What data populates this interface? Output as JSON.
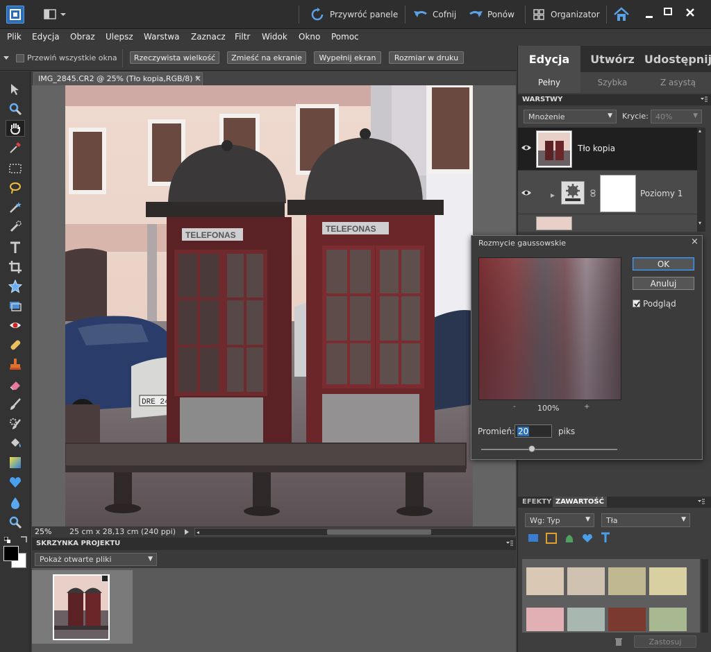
{
  "titlebar": {
    "restore_panels": "Przywróć panele",
    "undo": "Cofnij",
    "redo": "Ponów",
    "organizer": "Organizator"
  },
  "menu": [
    "Plik",
    "Edycja",
    "Obraz",
    "Ulepsz",
    "Warstwa",
    "Zaznacz",
    "Filtr",
    "Widok",
    "Okno",
    "Pomoc"
  ],
  "options": {
    "scroll_all_label": "Przewiń wszystkie okna",
    "actual_size": "Rzeczywista wielkość",
    "fit_screen": "Zmieść na ekranie",
    "fill_screen": "Wypełnij ekran",
    "print_size": "Rozmiar w druku"
  },
  "document": {
    "tab_title": "IMG_2845.CR2 @ 25% (Tło kopia,RGB/8) *",
    "close": "×",
    "zoom": "25%",
    "size_info": "25 cm x 28,13 cm (240 ppi)",
    "phone_sign": "TELEFONAS",
    "plate": "DRE 240"
  },
  "project_bin": {
    "title": "SKRZYNKA PROJEKTU",
    "dropdown": "Pokaż otwarte pliki"
  },
  "right_panel": {
    "tabs": [
      "Edycja",
      "Utwórz",
      "Udostępnij"
    ],
    "subtabs": [
      "Pełny",
      "Szybka",
      "Z asystą"
    ]
  },
  "layers": {
    "title": "WARSTWY",
    "blend_mode": "Mnożenie",
    "opacity_label": "Krycie:",
    "opacity_value": "40%",
    "items": [
      {
        "name": "Tło kopia"
      },
      {
        "name": "Poziomy 1"
      }
    ]
  },
  "effects": {
    "tab_effects": "EFEKTY",
    "tab_content": "ZAWARTOŚĆ",
    "filter_by": "Wg: Typ",
    "category": "Tła",
    "apply": "Zastosuj"
  },
  "gauss_dialog": {
    "title": "Rozmycie gaussowskie",
    "close": "×",
    "ok": "OK",
    "cancel": "Anuluj",
    "preview_label": "Podgląd",
    "preview_checked": true,
    "zoom": "100%",
    "zoom_minus": "-",
    "zoom_plus": "+",
    "radius_label": "Promień:",
    "radius_value": "20",
    "radius_unit": "piks",
    "slider_fraction": 0.37
  },
  "colors": {
    "accent_blue": "#2a6fb6",
    "panel_dark": "#2e2e2e",
    "highlight": "#1f1f1f"
  }
}
